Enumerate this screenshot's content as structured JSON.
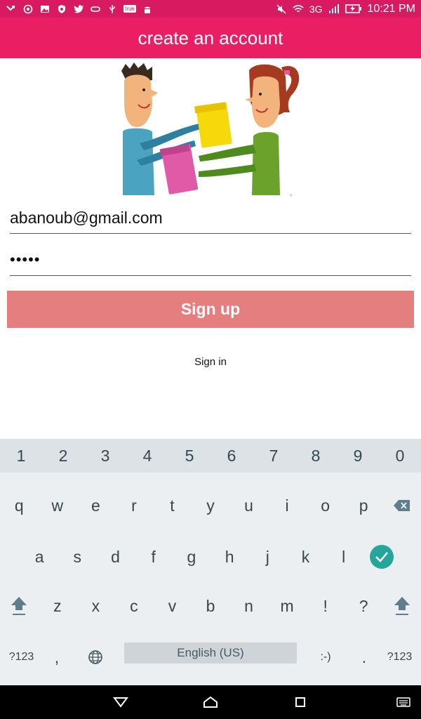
{
  "status_bar": {
    "time": "10:21 PM",
    "network": "3G",
    "left_icons": [
      "missed-call-icon",
      "whatsapp-icon",
      "image-icon",
      "shield-icon",
      "twitter-icon",
      "link-icon",
      "usb-icon",
      "true-app-icon",
      "android-icon"
    ],
    "right_icons": [
      "mute-icon",
      "wifi-icon",
      "signal-icon",
      "battery-charging-icon"
    ],
    "true_label": "true"
  },
  "app_bar": {
    "title": "create an account"
  },
  "form": {
    "email_value": "abanoub@gmail.com",
    "password_value": "•••••",
    "signup_label": "Sign up",
    "signin_label": "Sign in"
  },
  "keyboard": {
    "numbers": [
      "1",
      "2",
      "3",
      "4",
      "5",
      "6",
      "7",
      "8",
      "9",
      "0"
    ],
    "row1": [
      "q",
      "w",
      "e",
      "r",
      "t",
      "y",
      "u",
      "i",
      "o",
      "p"
    ],
    "row2": [
      "a",
      "s",
      "d",
      "f",
      "g",
      "h",
      "j",
      "k",
      "l"
    ],
    "row3": [
      "z",
      "x",
      "c",
      "v",
      "b",
      "n",
      "m",
      "!",
      "?"
    ],
    "symbols_label": "?123",
    "comma": ",",
    "space_label": "English (US)",
    "emoticon": ":-)",
    "period": ".",
    "accent": "#26a69a"
  },
  "colors": {
    "status_bar": "#d81b60",
    "app_bar": "#e91e63",
    "signup": "#e57e7e"
  }
}
